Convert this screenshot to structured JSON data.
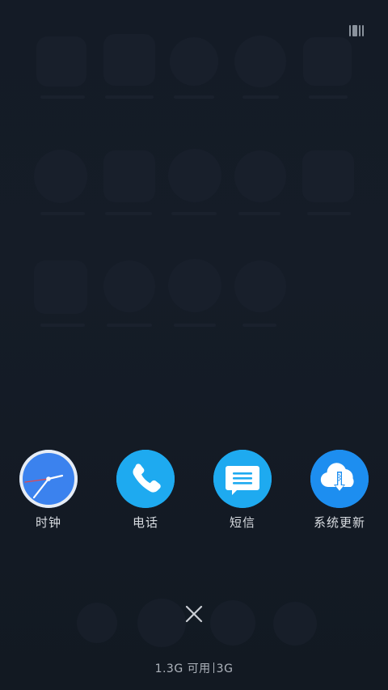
{
  "recent_apps": [
    {
      "label": "时钟",
      "icon": "clock-icon"
    },
    {
      "label": "电话",
      "icon": "phone-icon"
    },
    {
      "label": "短信",
      "icon": "message-icon"
    },
    {
      "label": "系统更新",
      "icon": "cloud-download-icon"
    }
  ],
  "memory": {
    "available": "1.3G 可用",
    "total": "3G"
  },
  "actions": {
    "close_icon": "close-icon",
    "menu_icon": "multi-window-icon"
  },
  "colors": {
    "background": "#131a24",
    "clock_blue": "#3b82ee",
    "app_cyan": "#1eaaf0",
    "update_blue": "#1d8ef0",
    "label_text": "#d8dce1",
    "secondary_text": "#aeb4bc"
  }
}
